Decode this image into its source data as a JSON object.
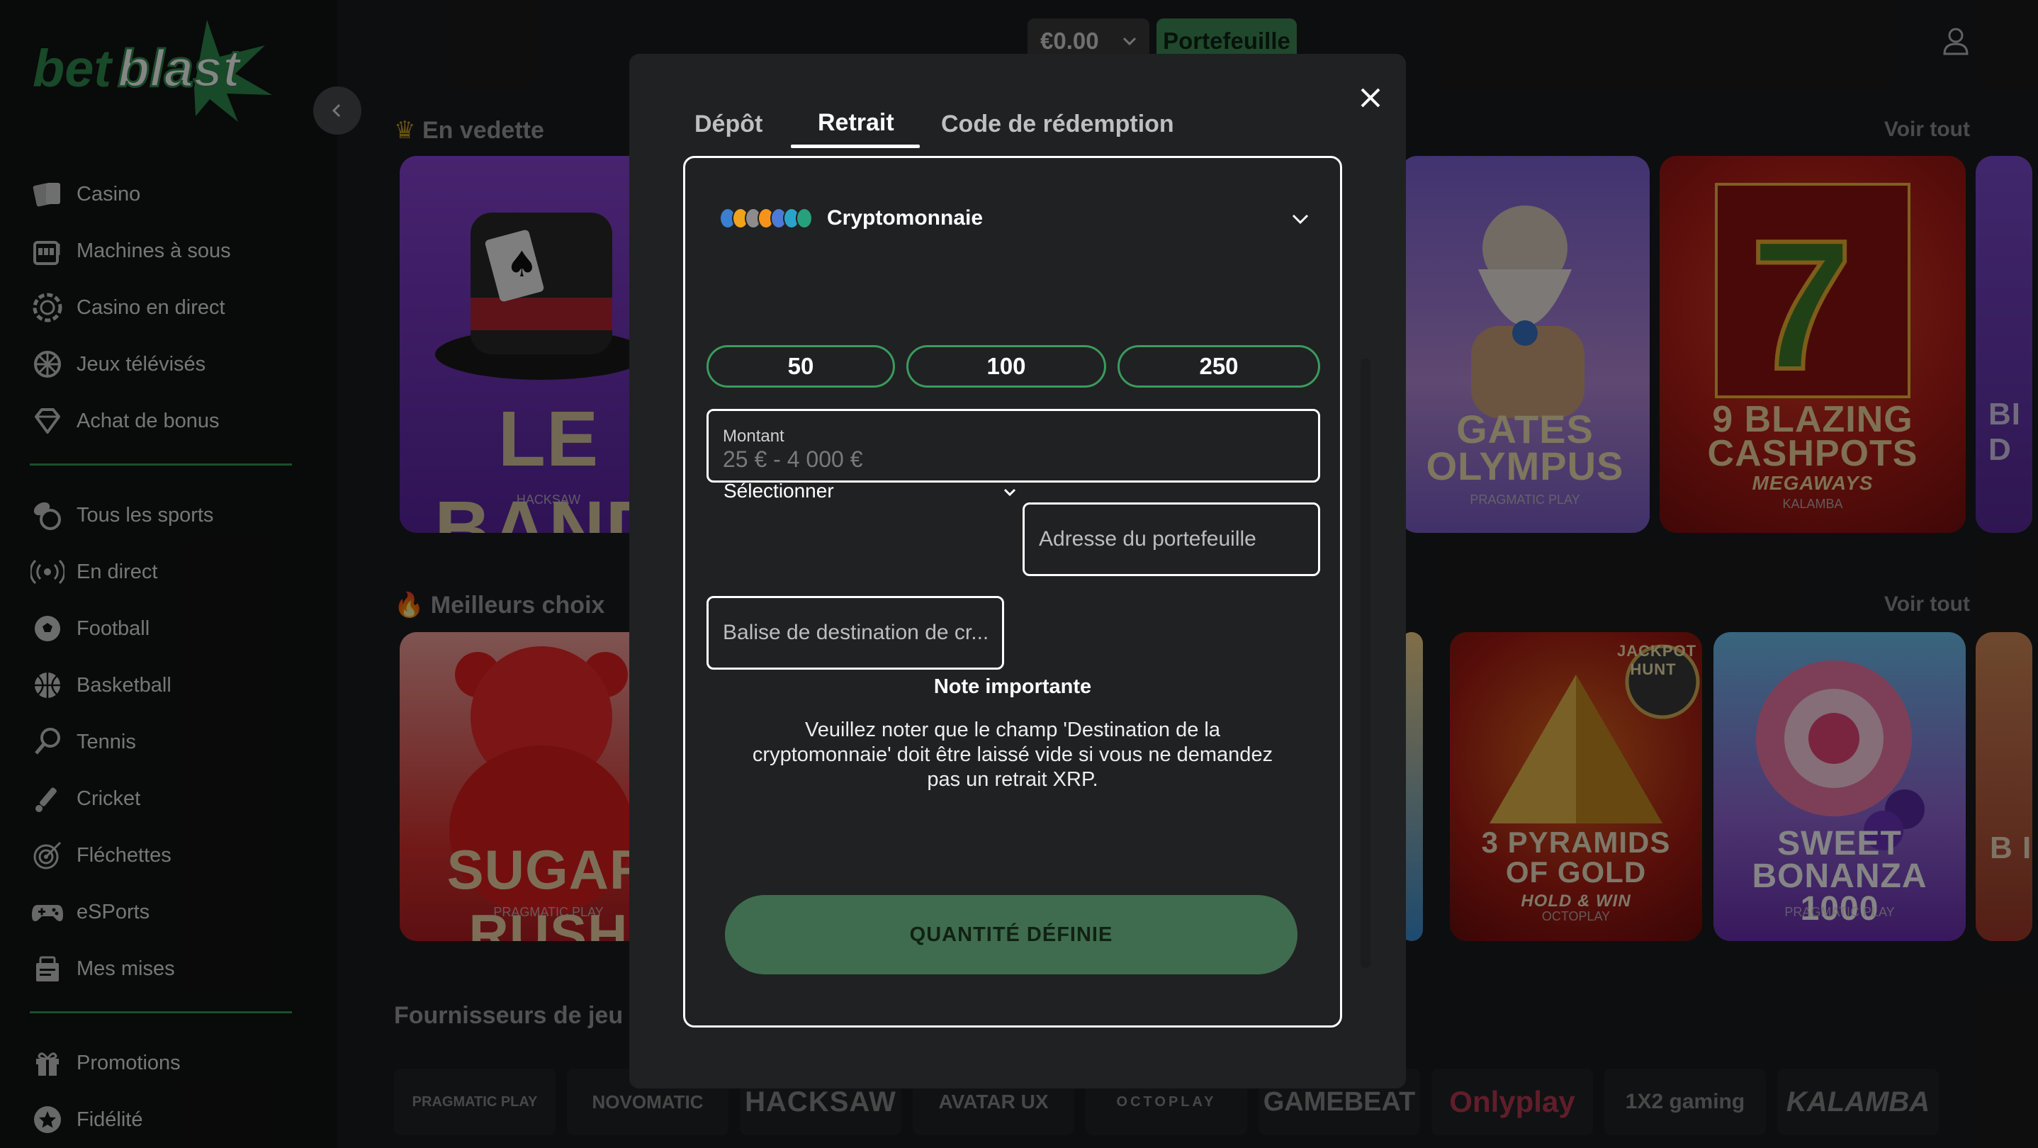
{
  "brand": {
    "name": "betblast",
    "accent": "#3a9b5d"
  },
  "header": {
    "balance": "€0.00",
    "wallet_label": "Portefeuille"
  },
  "sidebar": {
    "items_top": [
      {
        "label": "Casino",
        "icon": "casino-icon"
      },
      {
        "label": "Machines à sous",
        "icon": "slot-machine-icon"
      },
      {
        "label": "Casino en direct",
        "icon": "chip-icon"
      },
      {
        "label": "Jeux télévisés",
        "icon": "wheel-icon"
      },
      {
        "label": "Achat de bonus",
        "icon": "diamond-icon"
      }
    ],
    "items_sports": [
      {
        "label": "Tous les sports",
        "icon": "sports-icon"
      },
      {
        "label": "En direct",
        "icon": "live-icon"
      },
      {
        "label": "Football",
        "icon": "football-icon"
      },
      {
        "label": "Basketball",
        "icon": "basketball-icon"
      },
      {
        "label": "Tennis",
        "icon": "tennis-icon"
      },
      {
        "label": "Cricket",
        "icon": "cricket-icon"
      },
      {
        "label": "Fléchettes",
        "icon": "darts-icon"
      },
      {
        "label": "eSPorts",
        "icon": "gamepad-icon"
      },
      {
        "label": "Mes mises",
        "icon": "bets-icon"
      }
    ],
    "items_bottom": [
      {
        "label": "Promotions",
        "icon": "gift-icon"
      },
      {
        "label": "Fidélité",
        "icon": "star-icon"
      }
    ]
  },
  "main": {
    "featured_title": "En vedette",
    "top_picks_title": "Meilleurs choix",
    "providers_title": "Fournisseurs de jeu",
    "see_all": "Voir tout",
    "featured_games": [
      {
        "title": "LE BAND",
        "provider": "HACKSAW"
      },
      {
        "title": "GATES OLYMPUS",
        "provider": "PRAGMATIC PLAY"
      },
      {
        "title": "9 BLAZING CASHPOTS",
        "subtitle": "MEGAWAYS",
        "provider": "KALAMBA"
      },
      {
        "title": "BI D",
        "provider": ""
      }
    ],
    "top_games": [
      {
        "title": "SUGAR RUSH",
        "provider": "PRAGMATIC PLAY"
      },
      {
        "title": "3 PYRAMIDS OF GOLD",
        "subtitle": "HOLD & WIN",
        "badge": "JACKPOT HUNT",
        "provider": "OCTOPLAY"
      },
      {
        "title": "SWEET BONANZA 1000",
        "provider": "PRAGMATIC PLAY"
      },
      {
        "title": "B I",
        "provider": ""
      }
    ],
    "providers": [
      "PRAGMATIC PLAY",
      "NOVOMATIC",
      "HACKSAW",
      "AVATAR UX",
      "OCTOPLAY",
      "GAMEBEAT",
      "Onlyplay",
      "1X2 gaming",
      "KALAMBA"
    ]
  },
  "modal": {
    "tabs": [
      "Dépôt",
      "Retrait",
      "Code de rédemption"
    ],
    "active_tab": "Retrait",
    "method": "Cryptomonnaie",
    "presets": [
      "50",
      "100",
      "250"
    ],
    "amount_label": "Montant",
    "amount_placeholder": "25 € - 4 000 €",
    "select_label": "Sélectionner",
    "wallet_placeholder": "Adresse du portefeuille",
    "tag_placeholder": "Balise de destination de cr...",
    "note_title": "Note importante",
    "note_text": "Veuillez noter que le champ 'Destination de la cryptomonnaie' doit être laissé vide si vous ne demandez pas un retrait XRP.",
    "submit_label": "QUANTITÉ DÉFINIE"
  }
}
